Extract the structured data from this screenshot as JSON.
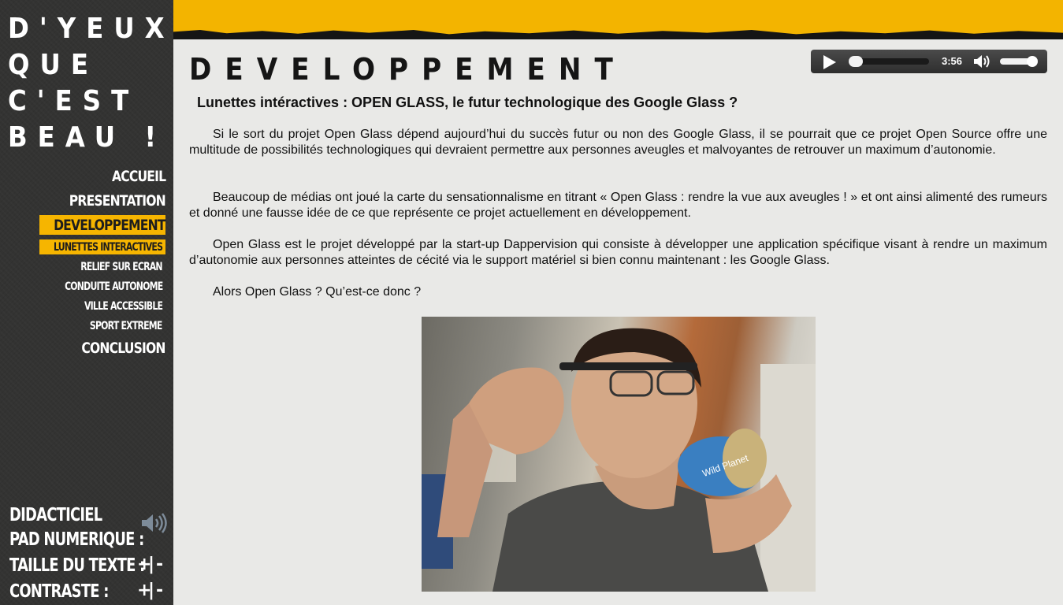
{
  "site": {
    "title": "D'YEUX\nQUE\nC'EST\nBEAU !"
  },
  "nav": {
    "items": [
      {
        "label": "ACCUEIL"
      },
      {
        "label": "PRESENTATION"
      },
      {
        "label": "DEVELOPPEMENT"
      },
      {
        "label": "LUNETTES INTERACTIVES"
      },
      {
        "label": "RELIEF SUR ECRAN"
      },
      {
        "label": "CONDUITE AUTONOME"
      },
      {
        "label": "VILLE ACCESSIBLE"
      },
      {
        "label": "SPORT EXTREME"
      },
      {
        "label": "CONCLUSION"
      }
    ],
    "active": "DEVELOPPEMENT",
    "active_sub": "LUNETTES INTERACTIVES"
  },
  "accessibility": {
    "tutorial_label": "DIDACTICIEL",
    "numpad_label": "PAD NUMERIQUE :",
    "text_size_label": "TAILLE DU TEXTE :",
    "contrast_label": "CONTRASTE :",
    "plus": "+",
    "sep": "|",
    "minus": "-"
  },
  "player": {
    "time": "3:56",
    "progress": 0.02,
    "volume": 0.9,
    "icons": [
      "play-icon",
      "volume-icon"
    ]
  },
  "page": {
    "heading": "DEVELOPPEMENT",
    "article_title": "Lunettes intéractives : OPEN GLASS, le futur technologique des Google Glass ?",
    "paragraphs": [
      "Si le sort du projet Open Glass dépend aujourd’hui du succès futur ou non des Google Glass, il se pourrait que ce projet Open Source offre une multitude de possibilités technologiques qui devraient permettre aux personnes aveugles et malvoyantes de retrouver un maximum d’autonomie.",
      "Beaucoup de médias ont joué la carte du sensationnalisme en titrant « Open Glass : rendre la vue aux aveugles ! » et ont ainsi alimenté des rumeurs et donné une fausse idée de ce que représente ce projet actuellement en développement.",
      "Open Glass est le projet développé par la start-up Dappervision qui consiste à développer une application spécifique visant à rendre un maximum d’autonomie aux personnes atteintes de cécité via le support matériel si bien connu maintenant : les Google Glass.",
      "Alors Open Glass ? Qu’est-ce donc ?"
    ],
    "photo_can_label": "Wild Planet"
  },
  "colors": {
    "accent": "#f3b400",
    "sidebar": "#333332",
    "background": "#e9e9e7"
  }
}
